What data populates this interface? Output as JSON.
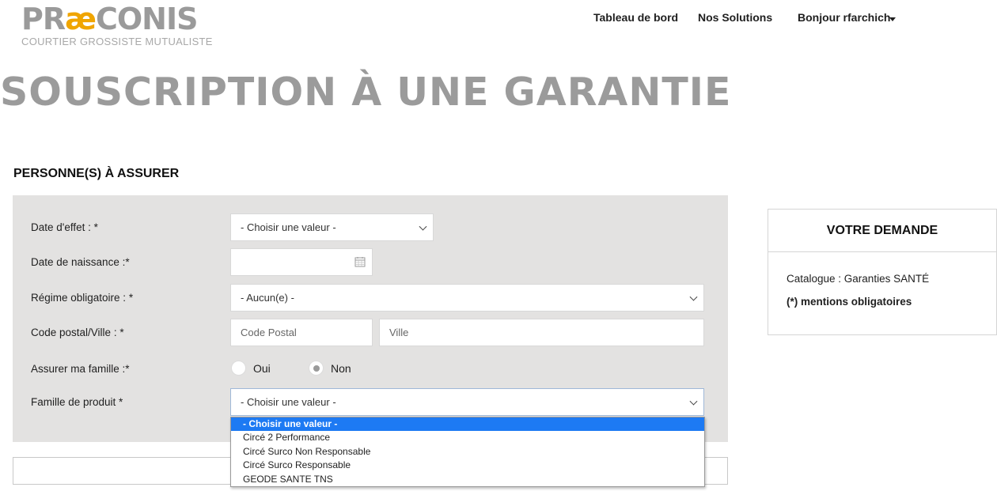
{
  "header": {
    "logo_text_1": "PR",
    "logo_text_ae": "æ",
    "logo_text_2": "CONIS",
    "logo_tagline": "COURTIER GROSSISTE MUTUALISTE",
    "nav": {
      "dashboard": "Tableau de bord",
      "solutions": "Nos Solutions",
      "user": "Bonjour rfarchich"
    }
  },
  "page": {
    "title": "SOUSCRIPTION À UNE GARANTIE",
    "section_title": "PERSONNE(S) À ASSURER"
  },
  "form": {
    "date_effet": {
      "label": "Date d'effet : *",
      "value": "- Choisir une valeur -"
    },
    "date_naissance": {
      "label": "Date de naissance :*",
      "value": ""
    },
    "regime": {
      "label": "Régime obligatoire : *",
      "value": "- Aucun(e) -"
    },
    "code_postal": {
      "label": "Code postal/Ville : *",
      "cp_placeholder": "Code Postal",
      "ville_placeholder": "Ville"
    },
    "famille": {
      "label": "Assurer ma famille :*",
      "oui": "Oui",
      "non": "Non",
      "selected": "Non"
    },
    "famille_produit": {
      "label": "Famille de produit *",
      "value": "- Choisir une valeur -",
      "options": [
        "- Choisir une valeur -",
        "Circé 2 Performance",
        "Circé Surco Non Responsable",
        "Circé Surco Responsable",
        "GEODE SANTE TNS"
      ]
    }
  },
  "card": {
    "title": "VOTRE DEMANDE",
    "catalogue": "Catalogue : Garanties SANTÉ",
    "mentions": "(*) mentions obligatoires"
  },
  "colors": {
    "accent": "#f0a500",
    "title_gray": "#9b9b9b",
    "panel_bg": "#e3e2e1",
    "selection_blue": "#1d7af3"
  }
}
